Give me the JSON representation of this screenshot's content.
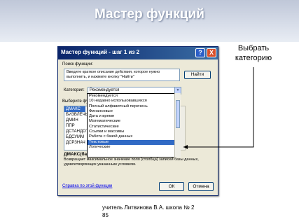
{
  "slide": {
    "title": "Мастер функций",
    "callout": [
      "Выбрать",
      "категорию"
    ],
    "footer_line1": "учитель Литвинова В.А.   школа № 2",
    "footer_line2": "85"
  },
  "dialog": {
    "title": "Мастер функций - шаг 1 из 2",
    "help_glyph": "?",
    "close_glyph": "X",
    "search_label": "Поиск функции:",
    "search_text": "Введите краткое описание действия, которое нужно выполнить, и нажмите кнопку \"Найти\"",
    "find_button": "Найти",
    "category_label": "Категория:",
    "category_value": "Рекомендуется",
    "select_function_label": "Выберите функ",
    "function_list": [
      "ДМАКС",
      "БИЗВЛЕЧЬ",
      "ДМИН",
      "ППР",
      "ДСТАНДОТ",
      "БДСУММ",
      "ДСРЗНАЧ"
    ],
    "selected_signature": "ДМАКС(ба",
    "description": "Возвращает максимальное значение поля (столбца) записей базы данных, удовлетворяющих указанным условиям.",
    "help_link": "Справка по этой функции",
    "ok_button": "ОК",
    "cancel_button": "Отмена"
  },
  "dropdown": {
    "items": [
      "Рекомендуется",
      "10 недавно использовавшихся",
      "Полный алфавитный перечень",
      "Финансовые",
      "Дата и время",
      "Математические",
      "Статистические",
      "Ссылки и массивы",
      "Работа с базой данных",
      "Текстовые",
      "Логические"
    ],
    "highlighted_index": 9
  }
}
